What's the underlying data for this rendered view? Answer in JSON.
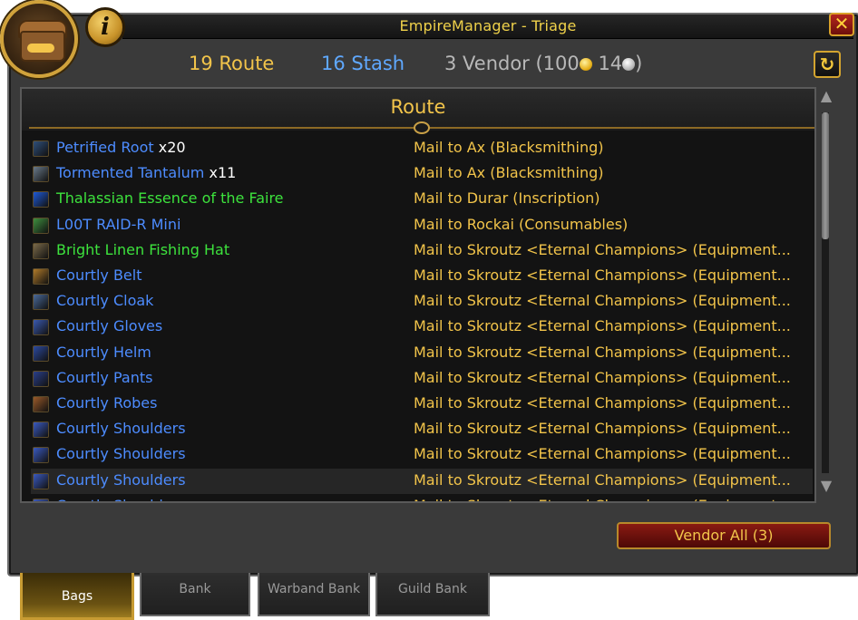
{
  "window": {
    "title": "EmpireManager - Triage",
    "close_glyph": "✕",
    "info_glyph": "i",
    "refresh_glyph": "↻"
  },
  "stats": {
    "route": "19 Route",
    "stash": "16 Stash",
    "vendor_prefix": "3 Vendor  (100",
    "vendor_mid": " 14",
    "vendor_suffix": ")"
  },
  "panel": {
    "title": "Route"
  },
  "rows": [
    {
      "name": "Petrified Root",
      "qty": " x20",
      "dest": "Mail to Ax (Blacksmithing)",
      "quality": "rare",
      "icon_color": "#2f4f7a"
    },
    {
      "name": "Tormented Tantalum",
      "qty": " x11",
      "dest": "Mail to Ax (Blacksmithing)",
      "quality": "rare",
      "icon_color": "#6a7a8a"
    },
    {
      "name": "Thalassian Essence of the Faire",
      "qty": "",
      "dest": "Mail to Durar (Inscription)",
      "quality": "uncommon",
      "icon_color": "#1e5ad8"
    },
    {
      "name": "L00T RAID-R Mini",
      "qty": "",
      "dest": "Mail to Rockai (Consumables)",
      "quality": "rare",
      "icon_color": "#3f8f3f"
    },
    {
      "name": "Bright Linen Fishing Hat",
      "qty": "",
      "dest": "Mail to Skroutz <Eternal Champions> (Equipment...",
      "quality": "uncommon",
      "icon_color": "#7a6a4a"
    },
    {
      "name": "Courtly Belt",
      "qty": "",
      "dest": "Mail to Skroutz <Eternal Champions> (Equipment...",
      "quality": "rare",
      "icon_color": "#b07a2a"
    },
    {
      "name": "Courtly Cloak",
      "qty": "",
      "dest": "Mail to Skroutz <Eternal Champions> (Equipment...",
      "quality": "rare",
      "icon_color": "#4a6a9a"
    },
    {
      "name": "Courtly Gloves",
      "qty": "",
      "dest": "Mail to Skroutz <Eternal Champions> (Equipment...",
      "quality": "rare",
      "icon_color": "#3a5ab0"
    },
    {
      "name": "Courtly Helm",
      "qty": "",
      "dest": "Mail to Skroutz <Eternal Champions> (Equipment...",
      "quality": "rare",
      "icon_color": "#2c4aa0"
    },
    {
      "name": "Courtly Pants",
      "qty": "",
      "dest": "Mail to Skroutz <Eternal Champions> (Equipment...",
      "quality": "rare",
      "icon_color": "#2a3f8a"
    },
    {
      "name": "Courtly Robes",
      "qty": "",
      "dest": "Mail to Skroutz <Eternal Champions> (Equipment...",
      "quality": "rare",
      "icon_color": "#9a5a2a"
    },
    {
      "name": "Courtly Shoulders",
      "qty": "",
      "dest": "Mail to Skroutz <Eternal Champions> (Equipment...",
      "quality": "rare",
      "icon_color": "#3a5ac0"
    },
    {
      "name": "Courtly Shoulders",
      "qty": "",
      "dest": "Mail to Skroutz <Eternal Champions> (Equipment...",
      "quality": "rare",
      "icon_color": "#3a5ac0"
    },
    {
      "name": "Courtly Shoulders",
      "qty": "",
      "dest": "Mail to Skroutz <Eternal Champions> (Equipment...",
      "quality": "rare",
      "icon_color": "#3a5ac0",
      "hover": true
    },
    {
      "name": "Courtly Shoulders",
      "qty": "",
      "dest": "Mail to Skroutz <Eternal Champions> (Equipment...",
      "quality": "rare",
      "icon_color": "#3a5ac0"
    }
  ],
  "vendor_button": "Vendor All (3)",
  "tabs": [
    {
      "label": "Bags",
      "active": true
    },
    {
      "label": "Bank",
      "active": false
    },
    {
      "label": "Warband Bank",
      "active": false
    },
    {
      "label": "Guild Bank",
      "active": false
    }
  ],
  "colors": {
    "gold_text": "#f2c44a",
    "rare": "#4d8cff",
    "uncommon": "#3de33d",
    "vendor_button_bg": "#6d100b"
  }
}
